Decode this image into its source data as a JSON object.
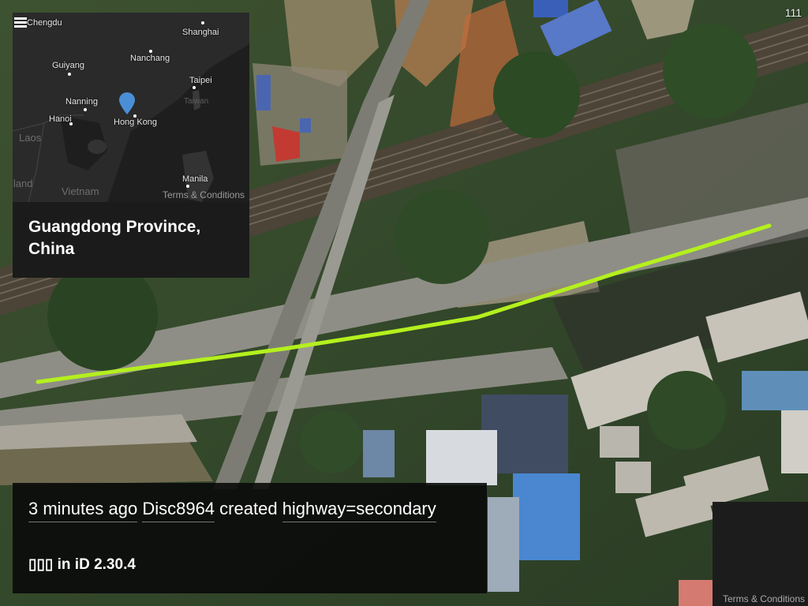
{
  "counter": "111",
  "overview": {
    "cities": {
      "chengdu": "Chengdu",
      "shanghai": "Shanghai",
      "guiyang": "Guiyang",
      "nanchang": "Nanchang",
      "taipei": "Taipei",
      "nanning": "Nanning",
      "hanoi": "Hanoi",
      "hong_kong": "Hong Kong",
      "manila": "Manila"
    },
    "regions": {
      "laos": "Laos",
      "thailand": "iland",
      "vietnam": "Vietnam",
      "taiwan": "Taiwan"
    },
    "terms": "Terms & Conditions",
    "place_name": "Guangdong Province, China",
    "marker_color": "#4a8fd6"
  },
  "edit": {
    "time": "3 minutes ago",
    "user": "Disc8964",
    "action": "created",
    "tag": "highway=secondary",
    "editor": "▯▯▯ in iD 2.30.4"
  },
  "attribution": {
    "terms": "Terms & Conditions"
  },
  "colors": {
    "highlight_line": "#b4f01e",
    "panel_bg": "#1b1b1b"
  }
}
